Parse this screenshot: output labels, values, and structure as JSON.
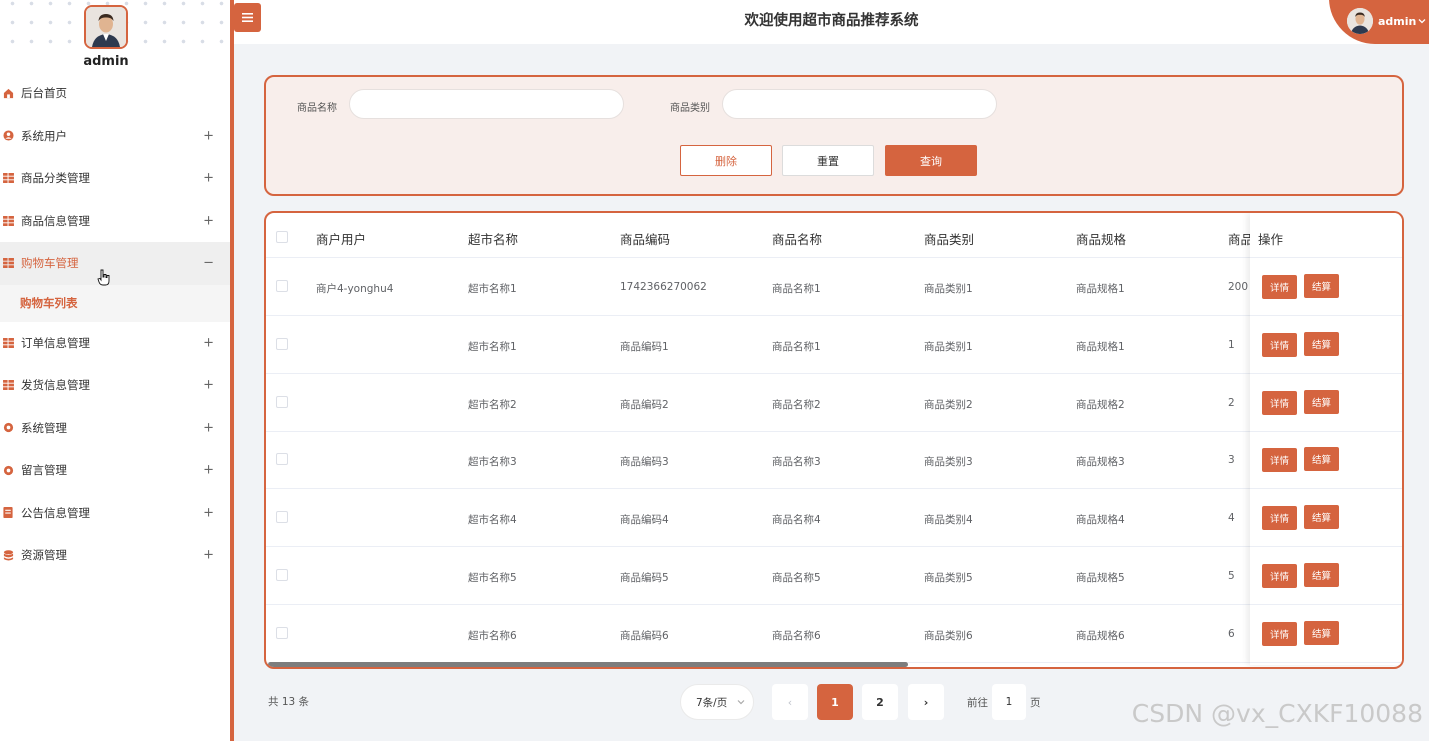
{
  "sidebar": {
    "username": "admin",
    "menu": [
      {
        "label": "后台首页",
        "icon": "home-icon",
        "expandable": false
      },
      {
        "label": "系统用户",
        "icon": "user-icon",
        "expandable": true,
        "toggle": "+"
      },
      {
        "label": "商品分类管理",
        "icon": "grid-icon",
        "expandable": true,
        "toggle": "+"
      },
      {
        "label": "商品信息管理",
        "icon": "grid-icon",
        "expandable": true,
        "toggle": "+"
      },
      {
        "label": "购物车管理",
        "icon": "grid-icon",
        "expandable": true,
        "toggle": "−",
        "active": true
      },
      {
        "label": "订单信息管理",
        "icon": "grid-icon",
        "expandable": true,
        "toggle": "+"
      },
      {
        "label": "发货信息管理",
        "icon": "grid-icon",
        "expandable": true,
        "toggle": "+"
      },
      {
        "label": "系统管理",
        "icon": "gear-icon",
        "expandable": true,
        "toggle": "+"
      },
      {
        "label": "留言管理",
        "icon": "gear-icon",
        "expandable": true,
        "toggle": "+"
      },
      {
        "label": "公告信息管理",
        "icon": "notice-icon",
        "expandable": true,
        "toggle": "+"
      },
      {
        "label": "资源管理",
        "icon": "database-icon",
        "expandable": true,
        "toggle": "+"
      }
    ],
    "submenu_label": "购物车列表"
  },
  "header": {
    "title": "欢迎使用超市商品推荐系统",
    "user_label": "admin"
  },
  "search": {
    "name_label": "商品名称",
    "name_value": "",
    "category_label": "商品类别",
    "category_value": "",
    "delete_label": "删除",
    "reset_label": "重置",
    "query_label": "查询"
  },
  "table": {
    "columns": [
      "商户用户",
      "超市名称",
      "商品编码",
      "商品名称",
      "商品类别",
      "商品规格",
      "商品",
      "操作"
    ],
    "rows": [
      [
        "商户4-yonghu4",
        "超市名称1",
        "1742366270062",
        "商品名称1",
        "商品类别1",
        "商品规格1",
        "200"
      ],
      [
        "",
        "超市名称1",
        "商品编码1",
        "商品名称1",
        "商品类别1",
        "商品规格1",
        "1"
      ],
      [
        "",
        "超市名称2",
        "商品编码2",
        "商品名称2",
        "商品类别2",
        "商品规格2",
        "2"
      ],
      [
        "",
        "超市名称3",
        "商品编码3",
        "商品名称3",
        "商品类别3",
        "商品规格3",
        "3"
      ],
      [
        "",
        "超市名称4",
        "商品编码4",
        "商品名称4",
        "商品类别4",
        "商品规格4",
        "4"
      ],
      [
        "",
        "超市名称5",
        "商品编码5",
        "商品名称5",
        "商品类别5",
        "商品规格5",
        "5"
      ],
      [
        "",
        "超市名称6",
        "商品编码6",
        "商品名称6",
        "商品类别6",
        "商品规格6",
        "6"
      ]
    ],
    "detail_label": "详情",
    "settle_label": "结算"
  },
  "pagination": {
    "total": "共 13 条",
    "page_size": "7条/页",
    "prev": "‹",
    "pages": [
      "1",
      "2"
    ],
    "current": "1",
    "next": "›",
    "goto_prefix": "前往",
    "goto_value": "1",
    "goto_suffix": "页"
  },
  "watermark": "CSDN @vx_CXKF10088",
  "colors": {
    "accent": "#d5643f",
    "panel_bg": "#f8eeeb",
    "page_bg": "#f1f3f6"
  }
}
